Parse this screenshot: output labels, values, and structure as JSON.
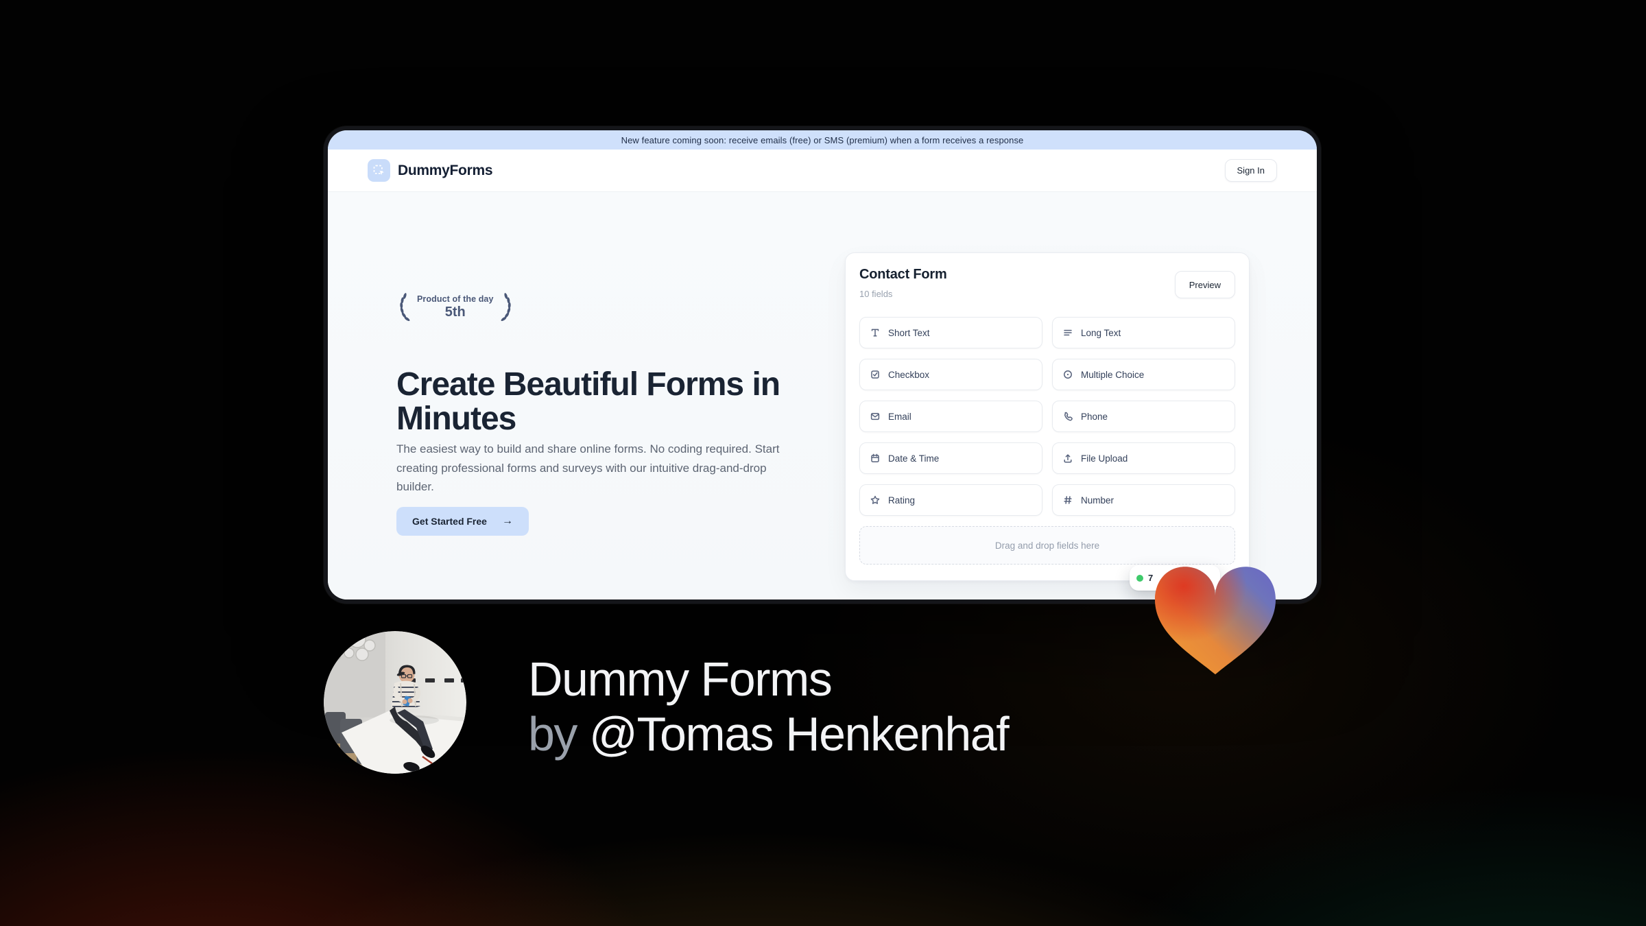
{
  "banner": {
    "text": "New feature coming soon: receive emails (free) or SMS (premium) when a form receives a response"
  },
  "header": {
    "brand": "DummyForms",
    "sign_in_label": "Sign In"
  },
  "hero": {
    "award_badge": {
      "line1": "Product of the day",
      "line2": "5th"
    },
    "title_line1": "Create Beautiful Forms in",
    "title_line2": "Minutes",
    "description": "The easiest way to build and share online forms. No coding required. Start creating professional forms and surveys with our intuitive drag-and-drop builder.",
    "cta_label": "Get Started Free",
    "cta_arrow": "→"
  },
  "form_card": {
    "title": "Contact Form",
    "subtitle": "10 fields",
    "preview_label": "Preview",
    "fields": [
      {
        "label": "Short Text",
        "icon": "short-text"
      },
      {
        "label": "Long Text",
        "icon": "long-text"
      },
      {
        "label": "Checkbox",
        "icon": "checkbox"
      },
      {
        "label": "Multiple Choice",
        "icon": "multiple-choice"
      },
      {
        "label": "Email",
        "icon": "email"
      },
      {
        "label": "Phone",
        "icon": "phone"
      },
      {
        "label": "Date & Time",
        "icon": "date-time"
      },
      {
        "label": "File Upload",
        "icon": "file-upload"
      },
      {
        "label": "Rating",
        "icon": "rating"
      },
      {
        "label": "Number",
        "icon": "number"
      }
    ],
    "dropzone_text": "Drag and drop fields here",
    "status_badge": {
      "visible_text": "7",
      "dot_color": "#3fca6b"
    }
  },
  "footer": {
    "product_name": "Dummy Forms",
    "byline_prefix": "by",
    "author": "@Tomas Henkenhaf"
  },
  "colors": {
    "banner_bg": "#cfe0fb",
    "accent": "#cddffb",
    "heading": "#1a2433",
    "muted": "#5d6573",
    "card_border": "#e9ecf1",
    "green": "#3fca6b"
  }
}
